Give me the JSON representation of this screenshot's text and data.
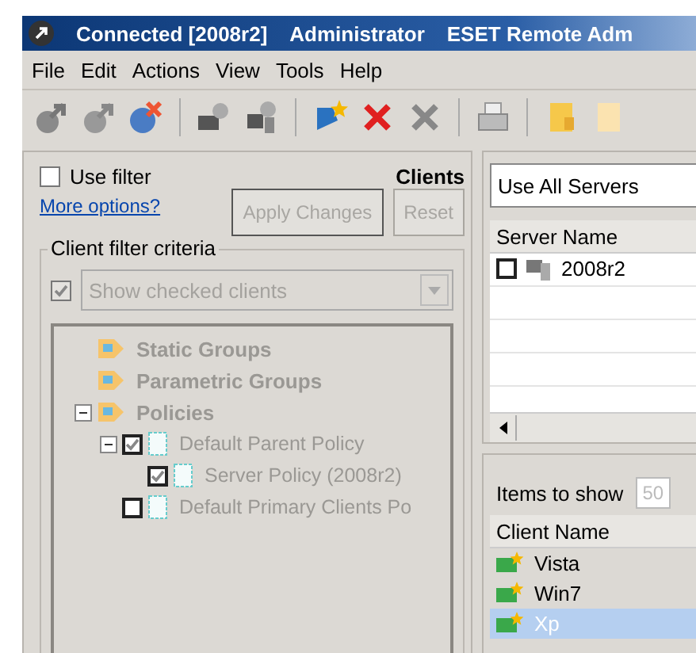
{
  "window": {
    "title_parts": [
      "Connected [2008r2]",
      "Administrator",
      "ESET Remote Adm"
    ]
  },
  "menu": [
    "File",
    "Edit",
    "Actions",
    "View",
    "Tools",
    "Help"
  ],
  "filter": {
    "use_filter": {
      "label": "Use filter",
      "checked": false
    },
    "more_options": "More options?",
    "title": "Clients",
    "apply": {
      "label": "Apply Changes",
      "disabled": true
    },
    "reset": {
      "label": "Reset",
      "disabled": true
    }
  },
  "criteria": {
    "legend": "Client filter criteria",
    "show_checked": {
      "checked": true,
      "disabled": true,
      "value": "Show checked clients"
    }
  },
  "tree": [
    {
      "label": "Static Groups",
      "kind": "group"
    },
    {
      "label": "Parametric Groups",
      "kind": "group"
    },
    {
      "label": "Policies",
      "kind": "group",
      "expanded": true,
      "children": [
        {
          "label": "Default Parent Policy",
          "kind": "policy",
          "checked": true,
          "expanded": true,
          "children": [
            {
              "label": "Server Policy (2008r2)",
              "kind": "policy",
              "checked": true
            }
          ]
        },
        {
          "label": "Default Primary Clients Po",
          "kind": "policy",
          "checked": false
        }
      ]
    }
  ],
  "servers": {
    "dropdown": "Use All Servers",
    "column": "Server Name",
    "rows": [
      {
        "name": "2008r2",
        "checked": false
      }
    ]
  },
  "clients": {
    "items_label": "Items to show",
    "items_value": "50",
    "column": "Client Name",
    "rows": [
      {
        "name": "Vista",
        "selected": false
      },
      {
        "name": "Win7",
        "selected": false
      },
      {
        "name": "Xp",
        "selected": true
      }
    ]
  }
}
